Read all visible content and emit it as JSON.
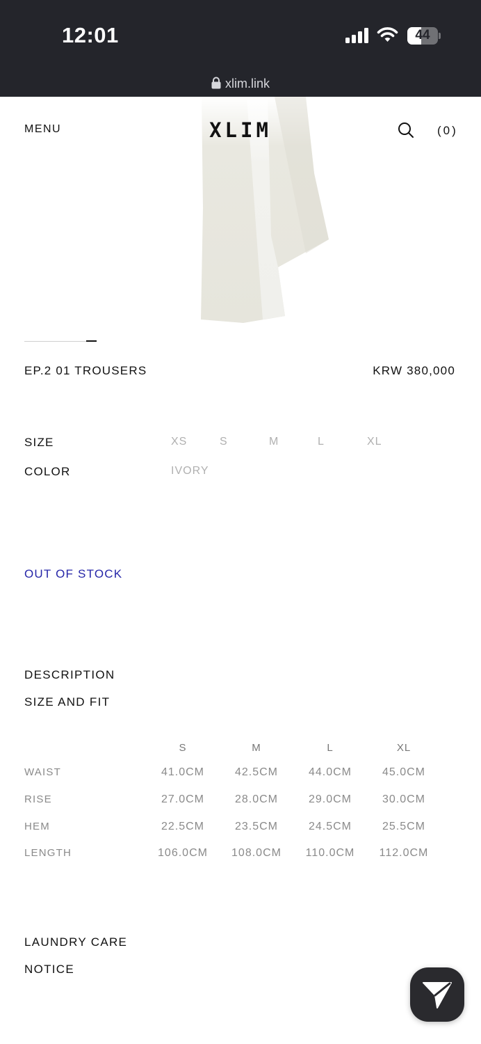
{
  "status_bar": {
    "time": "12:01",
    "battery_level": "44",
    "url": "xlim.link"
  },
  "header": {
    "menu_label": "MENU",
    "logo": "XLIM",
    "cart_count": "(0)"
  },
  "product": {
    "name": "EP.2 01 TROUSERS",
    "price": "KRW 380,000",
    "size_label": "SIZE",
    "sizes": [
      "XS",
      "S",
      "M",
      "L",
      "XL"
    ],
    "color_label": "COLOR",
    "colors": [
      "IVORY"
    ],
    "stock_status": "OUT OF STOCK",
    "stock_color": "#2626a8"
  },
  "sections": {
    "description": "DESCRIPTION",
    "size_and_fit": "SIZE AND FIT",
    "laundry_care": "LAUNDRY CARE",
    "notice": "NOTICE"
  },
  "size_table": {
    "columns": [
      "S",
      "M",
      "L",
      "XL"
    ],
    "rows": [
      {
        "label": "WAIST",
        "values": [
          "41.0CM",
          "42.5CM",
          "44.0CM",
          "45.0CM"
        ]
      },
      {
        "label": "RISE",
        "values": [
          "27.0CM",
          "28.0CM",
          "29.0CM",
          "30.0CM"
        ]
      },
      {
        "label": "HEM",
        "values": [
          "22.5CM",
          "23.5CM",
          "24.5CM",
          "25.5CM"
        ]
      },
      {
        "label": "LENGTH",
        "values": [
          "106.0CM",
          "108.0CM",
          "110.0CM",
          "112.0CM"
        ]
      }
    ]
  },
  "icons": {
    "search": "search-icon",
    "send": "send-icon",
    "lock": "lock-icon"
  }
}
